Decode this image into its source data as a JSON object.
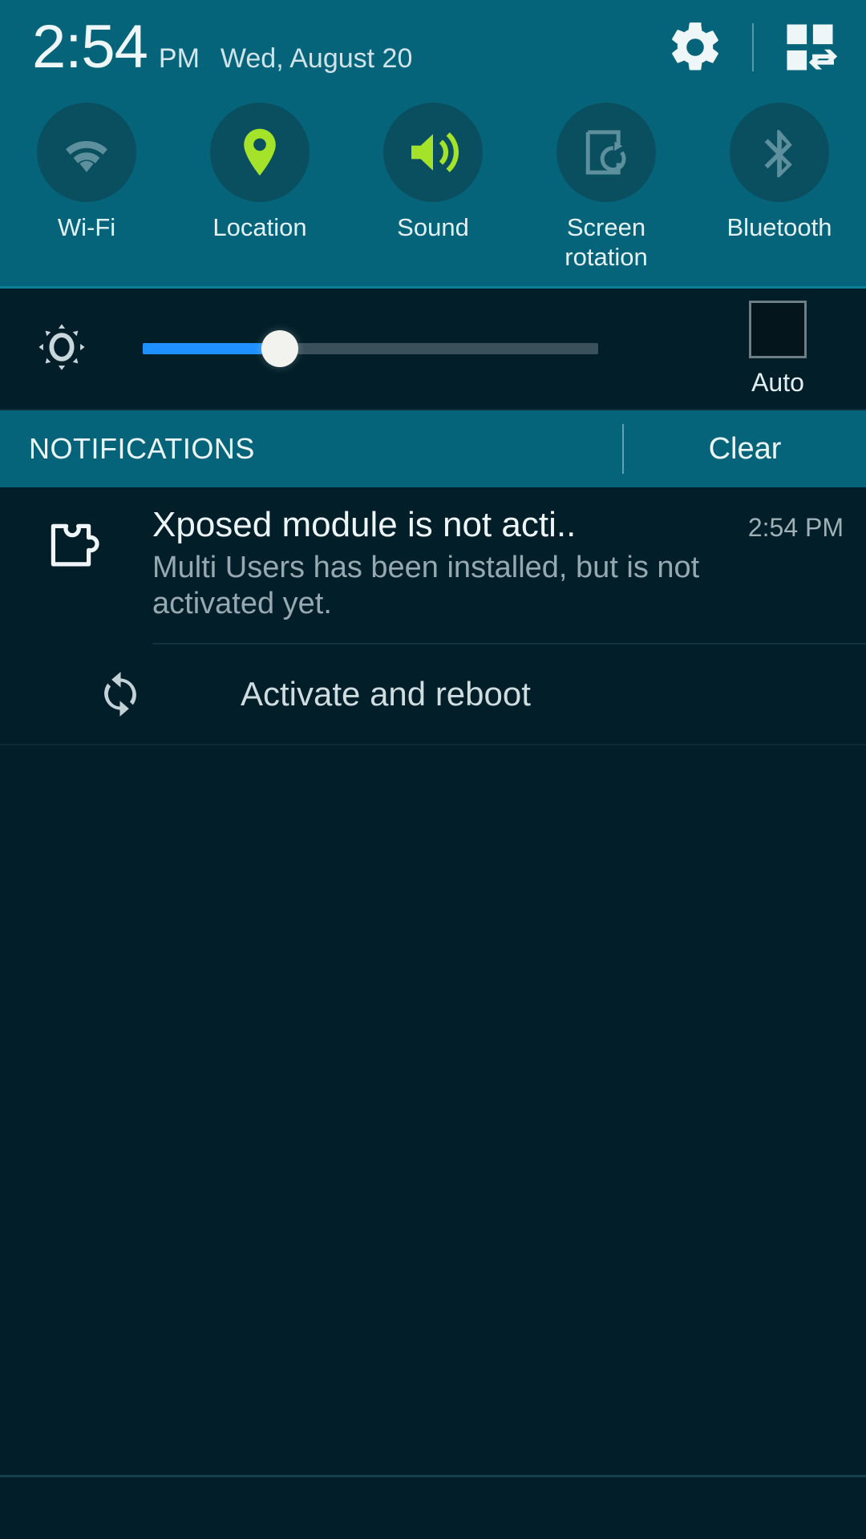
{
  "status_bar": {
    "time": "2:54",
    "ampm": "PM",
    "date": "Wed, August 20",
    "settings_icon": "gear-icon",
    "quick_settings_icon": "quick-settings-grid-icon"
  },
  "quick_toggles": [
    {
      "id": "wifi",
      "label": "Wi-Fi",
      "icon": "wifi-icon",
      "active": false
    },
    {
      "id": "location",
      "label": "Location",
      "icon": "location-pin-icon",
      "active": true
    },
    {
      "id": "sound",
      "label": "Sound",
      "icon": "sound-speaker-icon",
      "active": true
    },
    {
      "id": "rotation",
      "label": "Screen rotation",
      "icon": "screen-rotation-icon",
      "active": false
    },
    {
      "id": "bluetooth",
      "label": "Bluetooth",
      "icon": "bluetooth-icon",
      "active": false
    }
  ],
  "brightness": {
    "icon": "brightness-gear-icon",
    "value_percent": 22,
    "auto_label": "Auto",
    "auto_checked": false,
    "fill_color": "#1e90ff",
    "track_color": "#3a505a"
  },
  "notifications_bar": {
    "title": "NOTIFICATIONS",
    "clear_label": "Clear"
  },
  "notifications": [
    {
      "icon": "xposed-puzzle-icon",
      "title": "Xposed module is not acti..",
      "time": "2:54 PM",
      "text": "Multi Users has been installed, but is not activated yet.",
      "action": {
        "icon": "refresh-sync-icon",
        "label": "Activate and reboot"
      }
    }
  ],
  "colors": {
    "panel_teal": "#06647a",
    "toggle_circle": "#0a4f60",
    "active_green": "#a4e329",
    "inactive_gray": "#5d8f9c",
    "dark_bg": "#021e28"
  }
}
